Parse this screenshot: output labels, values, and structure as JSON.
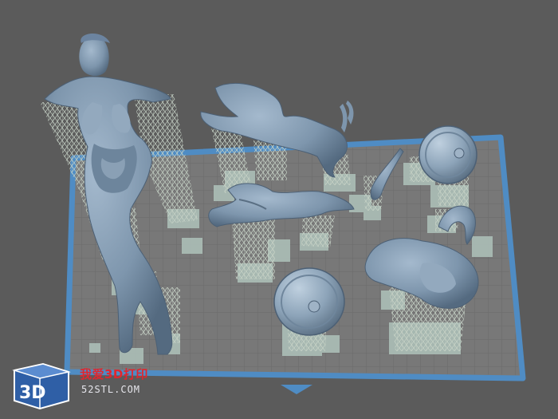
{
  "watermark": {
    "logo_text": "3D",
    "site_name_cn": "我爱3D打印",
    "url": "52STL.COM"
  },
  "colors": {
    "background": "#5b5b5b",
    "build_plate": "#7b7b7b",
    "plate_border": "#4f8cc4",
    "model": "#7e96ad",
    "support": "#b9c7ba",
    "raft": "#a6b8b2",
    "accent_red": "#e0272f"
  },
  "scene": {
    "models": [
      {
        "name": "female-figure"
      },
      {
        "name": "cape-piece-upper"
      },
      {
        "name": "cape-piece-lower"
      },
      {
        "name": "round-shield-upper"
      },
      {
        "name": "round-shield-lower"
      },
      {
        "name": "helmet-piece"
      },
      {
        "name": "curved-horn"
      },
      {
        "name": "small-spike"
      }
    ]
  }
}
